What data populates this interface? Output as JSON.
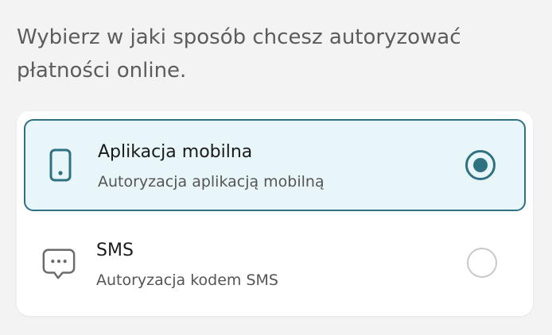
{
  "intro_text": "Wybierz w jaki sposób chcesz autoryzować płatności online.",
  "options": [
    {
      "title": "Aplikacja mobilna",
      "subtitle": "Autoryzacja aplikacją mobilną",
      "icon": "smartphone-icon",
      "selected": true
    },
    {
      "title": "SMS",
      "subtitle": "Autoryzacja kodem SMS",
      "icon": "chat-bubble-icon",
      "selected": false
    }
  ],
  "colors": {
    "accent": "#2e7282",
    "selected_bg": "#e8f6f9",
    "page_bg": "#f3f3f3",
    "icon_gray": "#6b6b6b",
    "radio_unselected": "#c8c8c8"
  }
}
